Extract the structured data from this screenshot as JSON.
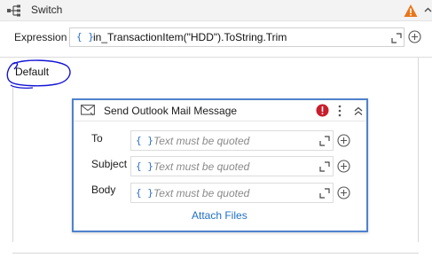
{
  "header": {
    "title": "Switch",
    "icon": "switch-icon",
    "warning_icon": "warning-icon",
    "warning_color": "#e8761a"
  },
  "expression": {
    "label": "Expression",
    "value": "in_TransactionItem(\"HDD\").ToString.Trim",
    "braces": "{ }"
  },
  "default_case": {
    "label": "Default",
    "annotation_color": "#1414d4"
  },
  "activity": {
    "title": "Send Outlook Mail Message",
    "icon": "mail-icon",
    "error_color": "#c81e2c",
    "accent": "#4f82cc",
    "properties": [
      {
        "label": "To",
        "braces": "{ }",
        "placeholder": "Text must be quoted"
      },
      {
        "label": "Subject",
        "braces": "{ }",
        "placeholder": "Text must be quoted"
      },
      {
        "label": "Body",
        "braces": "{ }",
        "placeholder": "Text must be quoted"
      }
    ],
    "attach_label": "Attach Files"
  }
}
